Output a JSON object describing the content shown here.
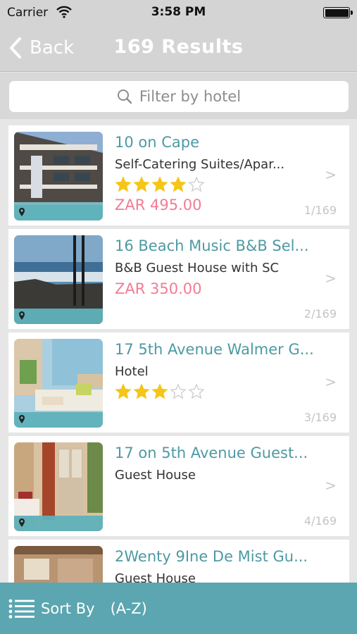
{
  "status": {
    "carrier": "Carrier",
    "time": "3:58 PM"
  },
  "nav": {
    "back_label": "Back",
    "title": "169 Results"
  },
  "search": {
    "placeholder": "Filter by hotel"
  },
  "results": [
    {
      "name": "10 on Cape",
      "type": "Self-Catering Suites/Apar...",
      "stars": 4,
      "price": "ZAR 495.00",
      "count": "1/169"
    },
    {
      "name": "16 Beach Music B&B Sel...",
      "type": "B&B Guest House with SC",
      "stars": 0,
      "price": "ZAR 350.00",
      "count": "2/169"
    },
    {
      "name": "17 5th Avenue Walmer G...",
      "type": "Hotel",
      "stars": 3,
      "price": "",
      "count": "3/169"
    },
    {
      "name": "17 on 5th Avenue Guest...",
      "type": "Guest House",
      "stars": 0,
      "price": "",
      "count": "4/169"
    },
    {
      "name": "2Wenty 9Ine De Mist Gu...",
      "type": "Guest House",
      "stars": 0,
      "price": "",
      "count": ""
    }
  ],
  "chevron": ">",
  "bottom": {
    "sort_label": "Sort By",
    "sort_value": "(A-Z)"
  },
  "colors": {
    "accent": "#5ba6b0",
    "name_text": "#4d9aa3",
    "price_text": "#f27c94",
    "star": "#f5c518"
  }
}
